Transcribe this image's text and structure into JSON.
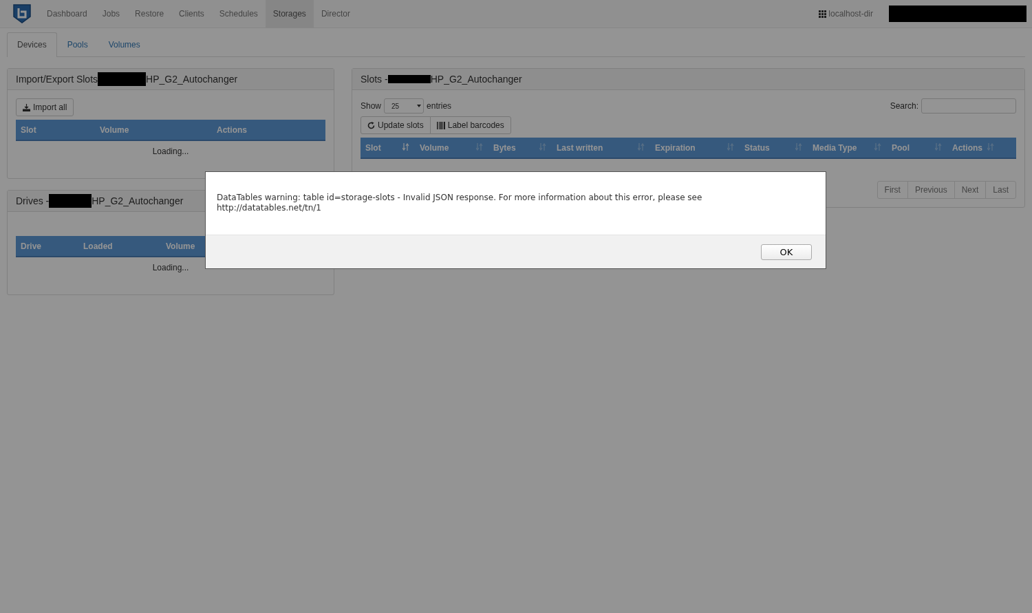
{
  "navbar": {
    "items": [
      {
        "label": "Dashboard",
        "selected": false
      },
      {
        "label": "Jobs",
        "selected": false
      },
      {
        "label": "Restore",
        "selected": false
      },
      {
        "label": "Clients",
        "selected": false
      },
      {
        "label": "Schedules",
        "selected": false
      },
      {
        "label": "Storages",
        "selected": true
      },
      {
        "label": "Director",
        "selected": false
      }
    ],
    "director": "localhost-dir"
  },
  "tabs": [
    {
      "label": "Devices",
      "selected": true
    },
    {
      "label": "Pools",
      "selected": false
    },
    {
      "label": "Volumes",
      "selected": false
    }
  ],
  "import_export_panel": {
    "title_prefix": "Import/Export Slots",
    "title_suffix": "HP_G2_Autochanger",
    "button": "Import all",
    "columns": [
      "Slot",
      "Volume",
      "Actions"
    ],
    "status": "Loading..."
  },
  "drives_panel": {
    "title_prefix": "Drives -",
    "title_suffix": "HP_G2_Autochanger",
    "columns": [
      "Drive",
      "Loaded",
      "Volume"
    ],
    "status": "Loading..."
  },
  "slots_panel": {
    "title_prefix": "Slots -",
    "title_suffix": "HP_G2_Autochanger",
    "show_label": "Show",
    "page_length": "25",
    "entries_label": "entries",
    "search_label": "Search:",
    "buttons": [
      "Update slots",
      "Label barcodes"
    ],
    "columns": [
      {
        "label": "Slot",
        "sorted": true
      },
      {
        "label": "Volume",
        "sorted": false
      },
      {
        "label": "Bytes",
        "sorted": false
      },
      {
        "label": "Last written",
        "sorted": false
      },
      {
        "label": "Expiration",
        "sorted": false
      },
      {
        "label": "Status",
        "sorted": false
      },
      {
        "label": "Media Type",
        "sorted": false
      },
      {
        "label": "Pool",
        "sorted": false
      },
      {
        "label": "Actions",
        "sorted": false
      }
    ],
    "pagination": [
      "First",
      "Previous",
      "Next",
      "Last"
    ]
  },
  "dialog": {
    "message": "DataTables warning: table id=storage-slots - Invalid JSON response. For more information about this error, please see http://datatables.net/tn/1",
    "button": "OK"
  }
}
